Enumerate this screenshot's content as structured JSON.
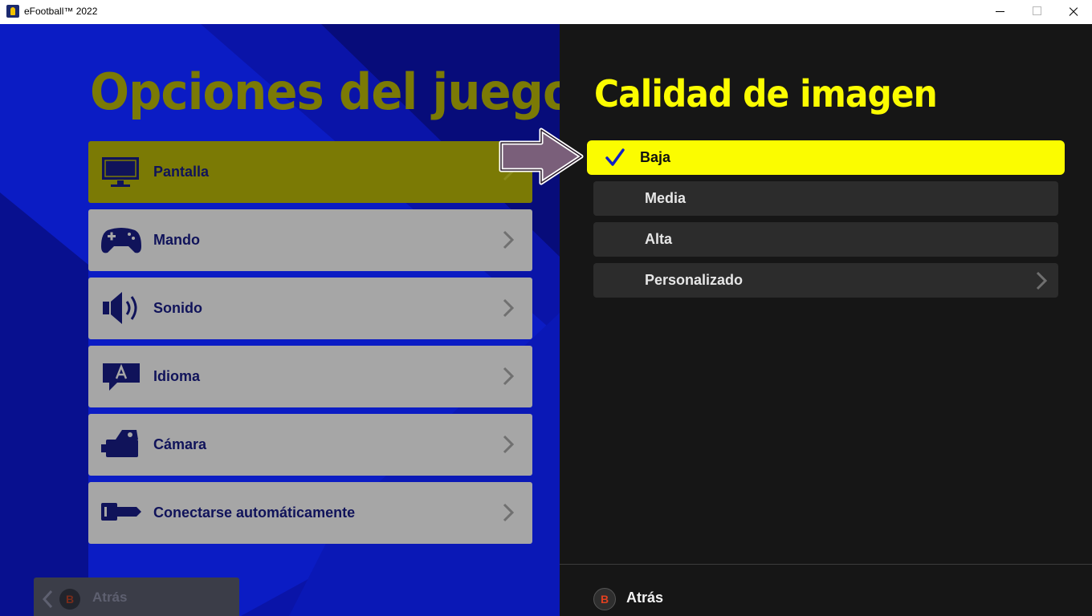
{
  "window": {
    "title": "eFootball™ 2022",
    "controls": [
      "minimize",
      "maximize",
      "close"
    ]
  },
  "left_panel": {
    "title": "Opciones del juego",
    "menu": [
      {
        "label": "Pantalla",
        "icon": "monitor-icon",
        "active": true
      },
      {
        "label": "Mando",
        "icon": "gamepad-icon",
        "active": false
      },
      {
        "label": "Sonido",
        "icon": "speaker-icon",
        "active": false
      },
      {
        "label": "Idioma",
        "icon": "language-bubble-icon",
        "active": false
      },
      {
        "label": "Cámara",
        "icon": "camera-icon",
        "active": false
      },
      {
        "label": "Conectarse automáticamente",
        "icon": "key-icon",
        "active": false
      }
    ],
    "back": {
      "button": "B",
      "label": "Atrás"
    }
  },
  "right_panel": {
    "title": "Calidad de imagen",
    "options": [
      {
        "label": "Baja",
        "selected": true
      },
      {
        "label": "Media",
        "selected": false
      },
      {
        "label": "Alta",
        "selected": false
      },
      {
        "label": "Personalizado",
        "selected": false,
        "has_submenu": true
      }
    ],
    "back": {
      "button": "B",
      "label": "Atrás"
    }
  },
  "colors": {
    "left_bg": "#070c7a",
    "accent_olive": "#7b7a05",
    "accent_yellow": "#fbfc00",
    "right_bg": "#161616",
    "menu_item_bg": "#a6a6a6"
  }
}
